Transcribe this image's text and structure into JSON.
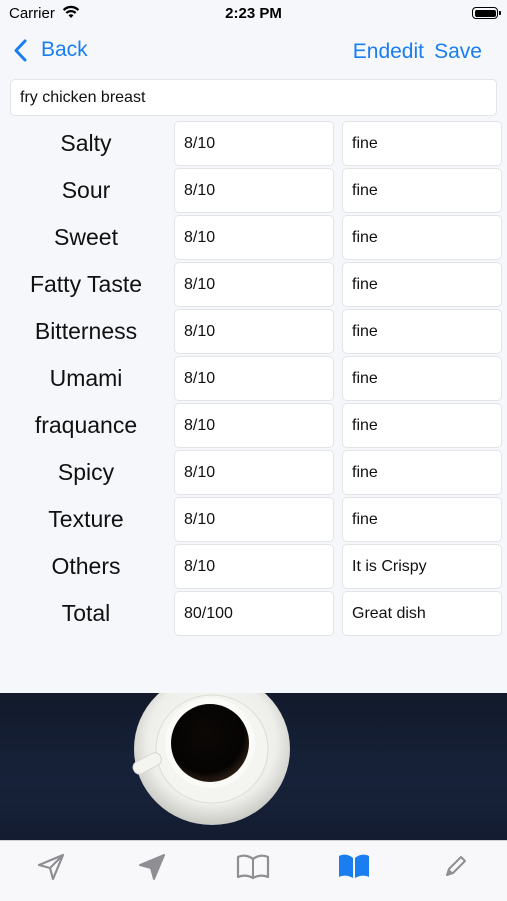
{
  "status_bar": {
    "carrier": "Carrier",
    "time": "2:23 PM",
    "icons": [
      "wifi-icon",
      "battery-icon"
    ]
  },
  "nav": {
    "back_label": "Back",
    "endedit_label": "Endedit",
    "save_label": "Save",
    "accent_color": "#1a7ef0"
  },
  "dish_name": "fry chicken breast",
  "ratings": [
    {
      "label": "Salty",
      "score": "8/10",
      "comment": "fine"
    },
    {
      "label": "Sour",
      "score": "8/10",
      "comment": "fine"
    },
    {
      "label": "Sweet",
      "score": "8/10",
      "comment": "fine"
    },
    {
      "label": "Fatty Taste",
      "score": "8/10",
      "comment": "fine"
    },
    {
      "label": "Bitterness",
      "score": "8/10",
      "comment": "fine"
    },
    {
      "label": "Umami",
      "score": "8/10",
      "comment": "fine"
    },
    {
      "label": "fraquance",
      "score": "8/10",
      "comment": "fine"
    },
    {
      "label": "Spicy",
      "score": "8/10",
      "comment": "fine"
    },
    {
      "label": "Texture",
      "score": "8/10",
      "comment": "fine"
    },
    {
      "label": "Others",
      "score": "8/10",
      "comment": "It is Crispy"
    },
    {
      "label": "Total",
      "score": "80/100",
      "comment": "Great dish"
    }
  ],
  "banner_image": "coffee-cup-image",
  "tab_bar": {
    "items": [
      {
        "icon": "paper-plane-outline-icon",
        "selected": false
      },
      {
        "icon": "paper-plane-filled-icon",
        "selected": false
      },
      {
        "icon": "book-outline-icon",
        "selected": false
      },
      {
        "icon": "book-filled-icon",
        "selected": true
      },
      {
        "icon": "pencil-icon",
        "selected": false
      }
    ],
    "selected_color": "#1a7ef0",
    "unselected_color": "#8e8e93"
  }
}
